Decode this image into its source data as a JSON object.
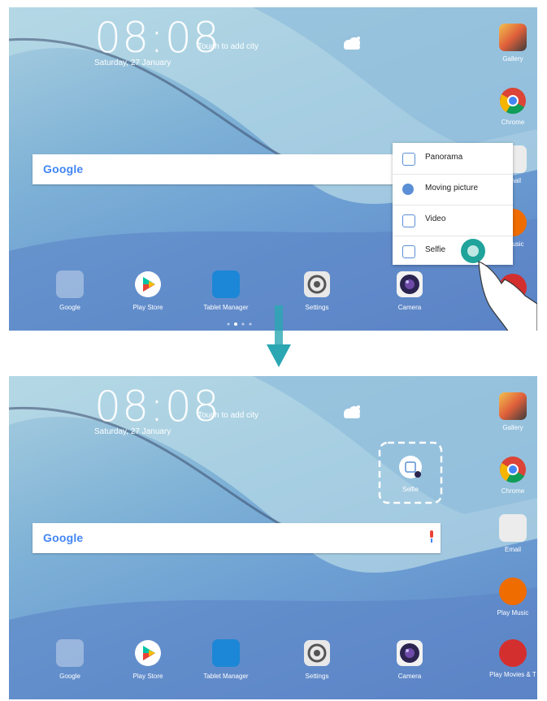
{
  "top": {
    "clock": "08:08",
    "touch_city": "Touch to add city",
    "date": "Saturday, 27 January",
    "search": {
      "logo": "Google"
    },
    "dock": [
      {
        "label": "Google",
        "icon": "folder-icon"
      },
      {
        "label": "Play Store",
        "icon": "play-store-icon"
      },
      {
        "label": "Tablet Manager",
        "icon": "tablet-manager-icon"
      },
      {
        "label": "Settings",
        "icon": "settings-icon"
      },
      {
        "label": "Camera",
        "icon": "camera-icon"
      }
    ],
    "side": [
      {
        "label": "Gallery",
        "icon": "gallery-icon"
      },
      {
        "label": "Chrome",
        "icon": "chrome-icon"
      },
      {
        "label": "Email",
        "icon": "email-icon"
      },
      {
        "label": "y Music",
        "icon": "play-music-icon"
      }
    ],
    "shortcut_menu": [
      {
        "label": "Panorama",
        "icon": "panorama-icon"
      },
      {
        "label": "Moving picture",
        "icon": "moving-picture-icon"
      },
      {
        "label": "Video",
        "icon": "video-icon"
      },
      {
        "label": "Selfie",
        "icon": "selfie-icon"
      }
    ]
  },
  "bottom": {
    "clock": "08:08",
    "touch_city": "Touch to add city",
    "date": "Saturday, 27 January",
    "search": {
      "logo": "Google"
    },
    "shortcut": {
      "label": "Selfie",
      "icon": "selfie-shortcut-icon"
    },
    "dock": [
      {
        "label": "Google",
        "icon": "folder-icon"
      },
      {
        "label": "Play Store",
        "icon": "play-store-icon"
      },
      {
        "label": "Tablet Manager",
        "icon": "tablet-manager-icon"
      },
      {
        "label": "Settings",
        "icon": "settings-icon"
      },
      {
        "label": "Camera",
        "icon": "camera-icon"
      }
    ],
    "side": [
      {
        "label": "Gallery",
        "icon": "gallery-icon"
      },
      {
        "label": "Chrome",
        "icon": "chrome-icon"
      },
      {
        "label": "Email",
        "icon": "email-icon"
      },
      {
        "label": "Play Music",
        "icon": "play-music-icon"
      },
      {
        "label": "Play Movies & T",
        "icon": "play-movies-icon"
      }
    ]
  },
  "colors": {
    "arrow": "#2aa7b3",
    "highlight": "#1fa39b"
  }
}
